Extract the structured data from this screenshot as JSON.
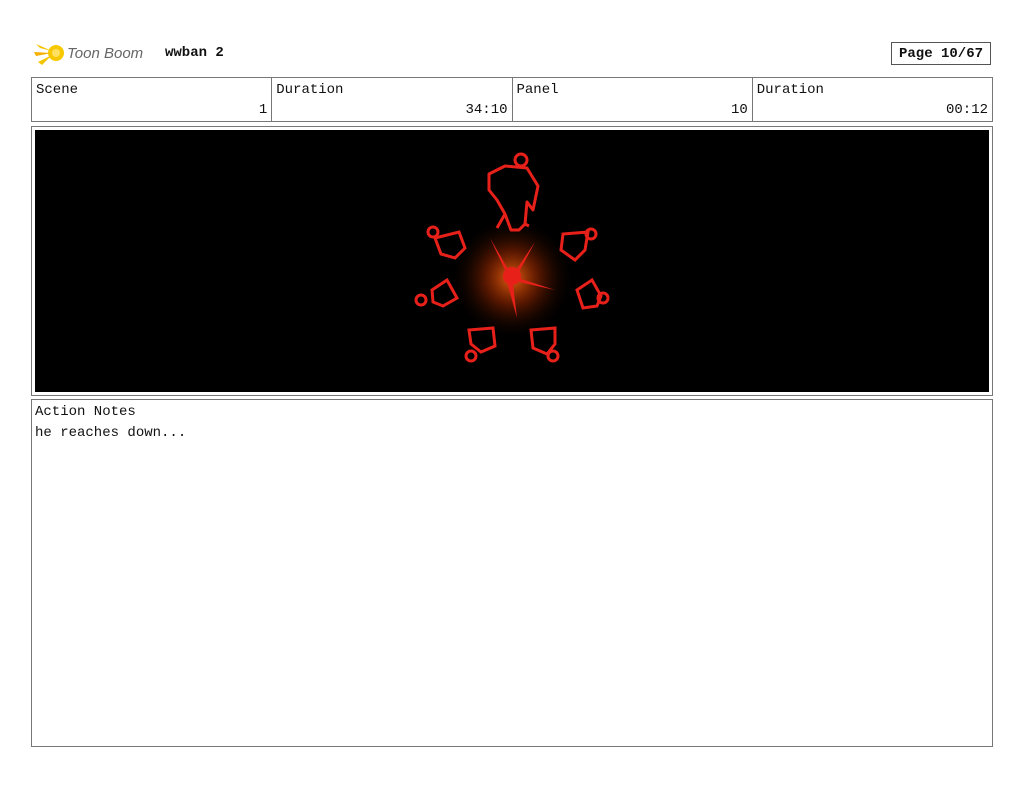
{
  "header": {
    "logo_text": "Toon Boom",
    "project": "wwban 2",
    "page": "Page 10/67"
  },
  "info": {
    "scene_label": "Scene",
    "scene_value": "1",
    "scene_duration_label": "Duration",
    "scene_duration_value": "34:10",
    "panel_label": "Panel",
    "panel_value": "10",
    "panel_duration_label": "Duration",
    "panel_duration_value": "00:12"
  },
  "panel_image": {
    "icon": "summoning-circle-illustration",
    "background": "#000000",
    "accent": "#e8201a"
  },
  "notes": {
    "label": "Action Notes",
    "text": "he reaches down..."
  }
}
